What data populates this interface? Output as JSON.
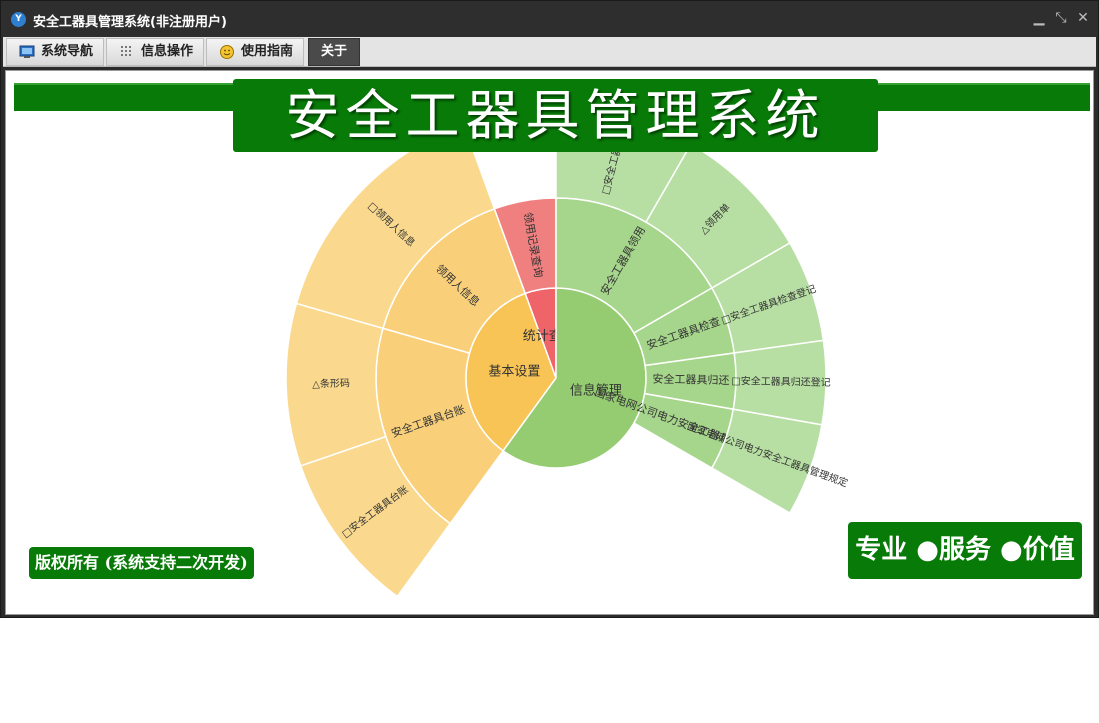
{
  "window": {
    "title": "安全工器具管理系统(非注册用户)",
    "icon": "app-logo-icon",
    "controls": {
      "minimize": "▁",
      "restore": "⤡",
      "close": "✕"
    }
  },
  "menu": {
    "tabs": [
      {
        "label": "系统导航",
        "icon": "monitor-icon",
        "active": false
      },
      {
        "label": "信息操作",
        "icon": "grid-icon",
        "active": false
      },
      {
        "label": "使用指南",
        "icon": "smiley-icon",
        "active": false
      },
      {
        "label": "关于",
        "icon": "",
        "active": true
      }
    ]
  },
  "main": {
    "banner": "安全工器具管理系统",
    "copyright": "版权所有 (系统支持二次开发)",
    "slogan": "专业 ●服务 ●价值"
  },
  "colors": {
    "brand_green": "#087a08",
    "info_green_inner": "#95cc72",
    "info_green_mid": "#a6d68b",
    "info_green_outer": "#b7dfa3",
    "basic_yellow_inner": "#f8c456",
    "basic_yellow_mid": "#f9d079",
    "basic_yellow_outer": "#fad98f",
    "stats_red_inner": "#ee6468",
    "stats_red_outer": "#f08080"
  },
  "chart_data": {
    "type": "sunburst",
    "tree": [
      {
        "name": "基本设置",
        "color": "basic_yellow",
        "children": [
          {
            "name": "领用人信息",
            "children": [
              {
                "name": "□领用人信息"
              }
            ]
          },
          {
            "name": "安全工器具台账",
            "children": [
              {
                "name": "△条形码"
              },
              {
                "name": "□安全工器具台账"
              }
            ]
          }
        ]
      },
      {
        "name": "统计查询",
        "color": "stats_red",
        "children": [
          {
            "name": "领用记录查询"
          }
        ]
      },
      {
        "name": "信息管理",
        "color": "info_green",
        "children": [
          {
            "name": "安全工器具领用",
            "children": [
              {
                "name": "□安全工器具领"
              },
              {
                "name": "△领用单"
              }
            ]
          },
          {
            "name": "安全工器具检查",
            "children": [
              {
                "name": "□安全工器具检查登记"
              }
            ]
          },
          {
            "name": "安全工器具归还",
            "children": [
              {
                "name": "□安全工器具归还登记"
              }
            ]
          },
          {
            "name": "国家电网公司电力安全工器具管理规定",
            "children": [
              {
                "name": "国家电网公司电力安全工器具管理规定"
              }
            ]
          }
        ]
      }
    ]
  }
}
